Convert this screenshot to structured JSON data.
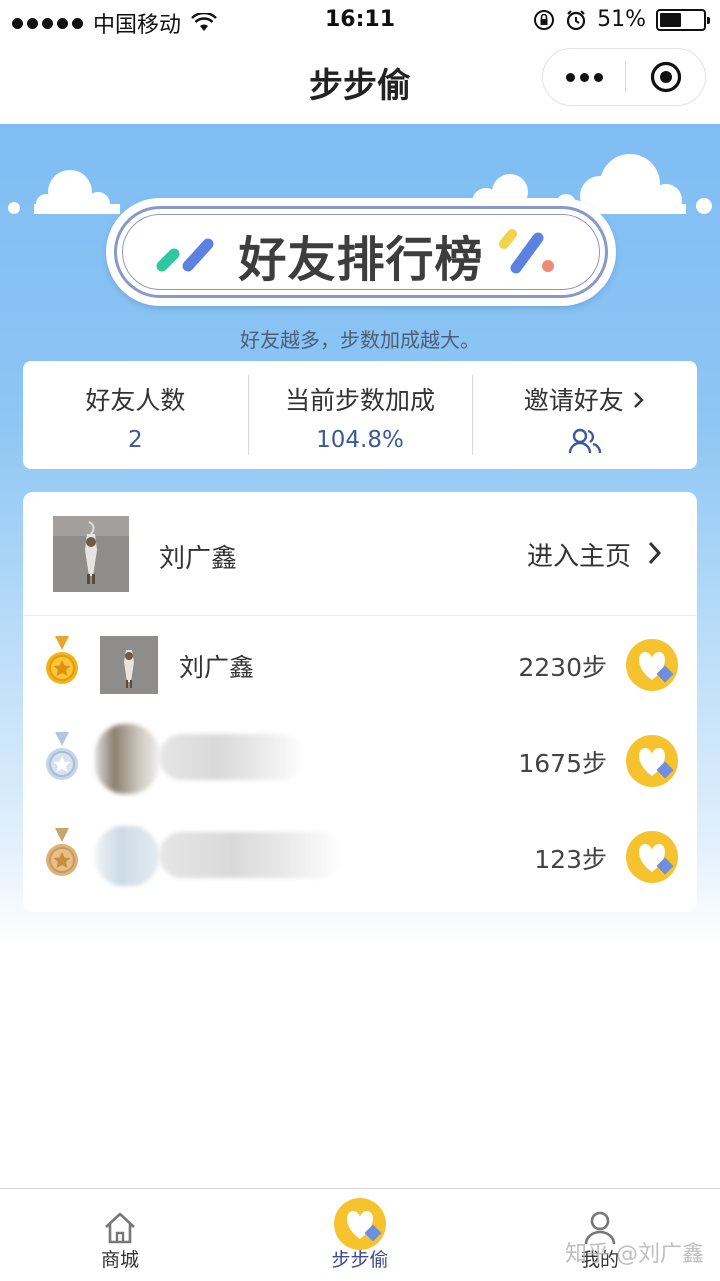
{
  "status_bar": {
    "carrier": "中国移动",
    "time": "16:11",
    "battery": "51%",
    "battery_level": 0.51
  },
  "nav": {
    "title": "步步偷"
  },
  "banner": {
    "title": "好友排行榜",
    "subtitle": "好友越多，步数加成越大。"
  },
  "stats": {
    "friends_label": "好友人数",
    "friends_value": "2",
    "bonus_label": "当前步数加成",
    "bonus_value": "104.8%",
    "invite_label": "邀请好友"
  },
  "me": {
    "name": "刘广鑫",
    "link_label": "进入主页"
  },
  "ranking": [
    {
      "name": "刘广鑫",
      "steps": "2230步",
      "medal": "gold"
    },
    {
      "name": "",
      "steps": "1675步",
      "medal": "silver"
    },
    {
      "name": "",
      "steps": "123步",
      "medal": "bronze"
    }
  ],
  "tabs": [
    {
      "label": "商城",
      "icon": "home-icon"
    },
    {
      "label": "步步偷",
      "icon": "heart-coin-icon",
      "active": true
    },
    {
      "label": "我的",
      "icon": "person-icon"
    }
  ],
  "watermark": "知乎 @刘广鑫",
  "colors": {
    "sky_top": "#7fbdf3",
    "accent_blue": "#3b5a9d",
    "coin_yellow": "#f6c22d"
  }
}
